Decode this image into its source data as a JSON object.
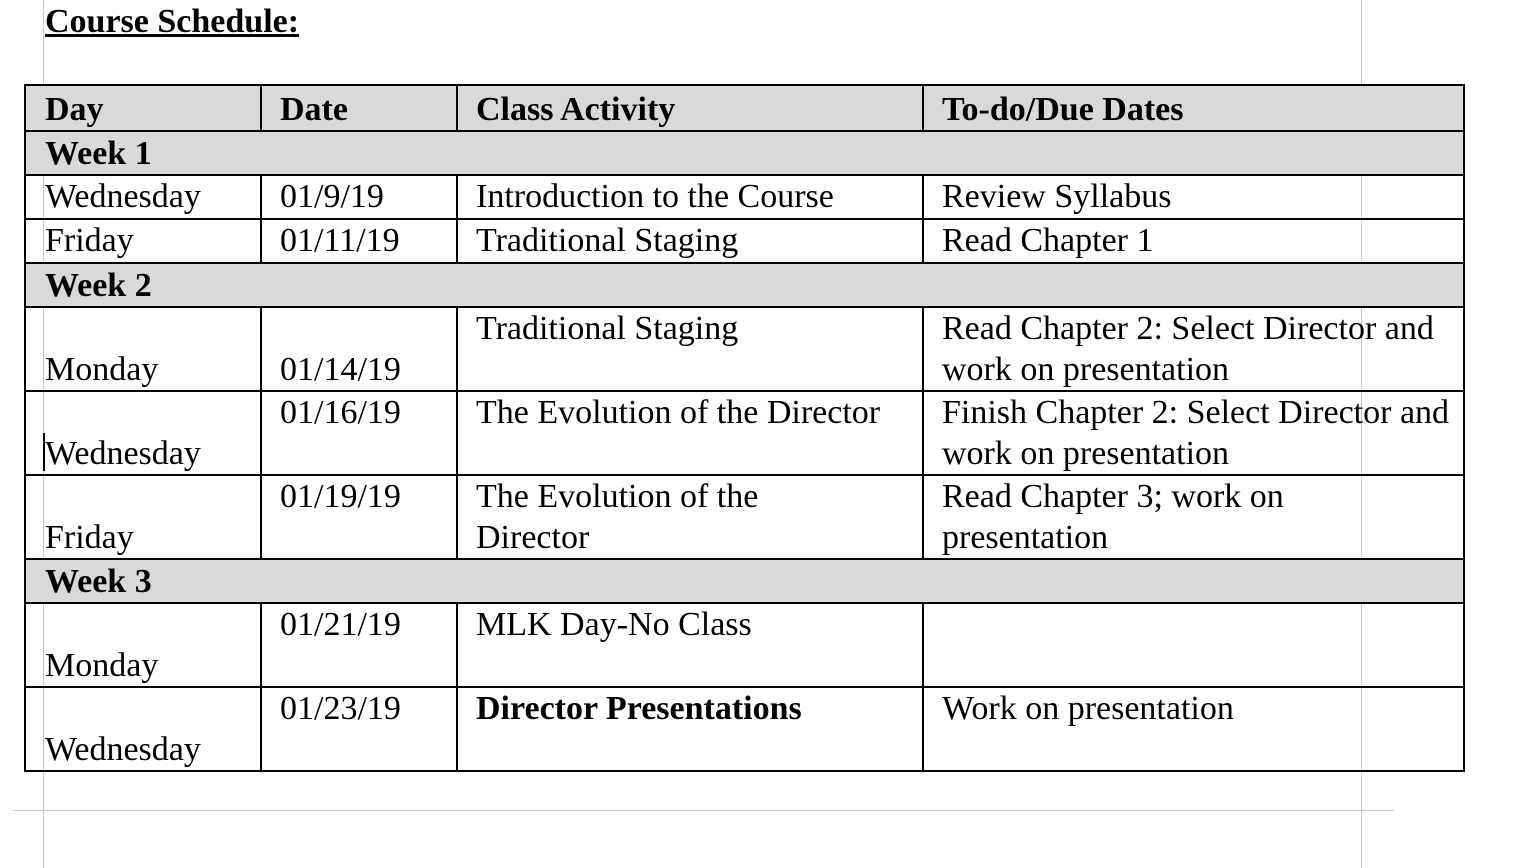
{
  "heading": "Course Schedule:",
  "columns": [
    "Day",
    "Date",
    "Class Activity",
    "To-do/Due Dates"
  ],
  "weeks": [
    {
      "label": "Week 1",
      "rows": [
        {
          "day": "Wednesday",
          "date": "01/9/19",
          "activity": "Introduction to the Course",
          "todo": "Review Syllabus"
        },
        {
          "day": "Friday",
          "date": "01/11/19",
          "activity": "Traditional Staging",
          "todo": "Read Chapter 1"
        }
      ]
    },
    {
      "label": "Week 2",
      "rows": [
        {
          "day": "Monday",
          "date": "01/14/19",
          "activity": "Traditional Staging",
          "todo": "Read Chapter 2: Select Director and work on presentation"
        },
        {
          "day": "Wednesday",
          "date": "01/16/19",
          "activity": "The Evolution of the Director",
          "todo": "Finish Chapter 2: Select Director and work on presentation"
        },
        {
          "day": "Friday",
          "date": "01/19/19",
          "activity": "The Evolution of the Director",
          "todo": "Read Chapter 3; work on presentation"
        }
      ]
    },
    {
      "label": "Week 3",
      "rows": [
        {
          "day": "Monday",
          "date": "01/21/19",
          "activity": "MLK Day-No Class",
          "todo": ""
        },
        {
          "day": "Wednesday",
          "date": "01/23/19",
          "activity": "Director Presentations",
          "todo": "Work on presentation"
        }
      ]
    }
  ]
}
